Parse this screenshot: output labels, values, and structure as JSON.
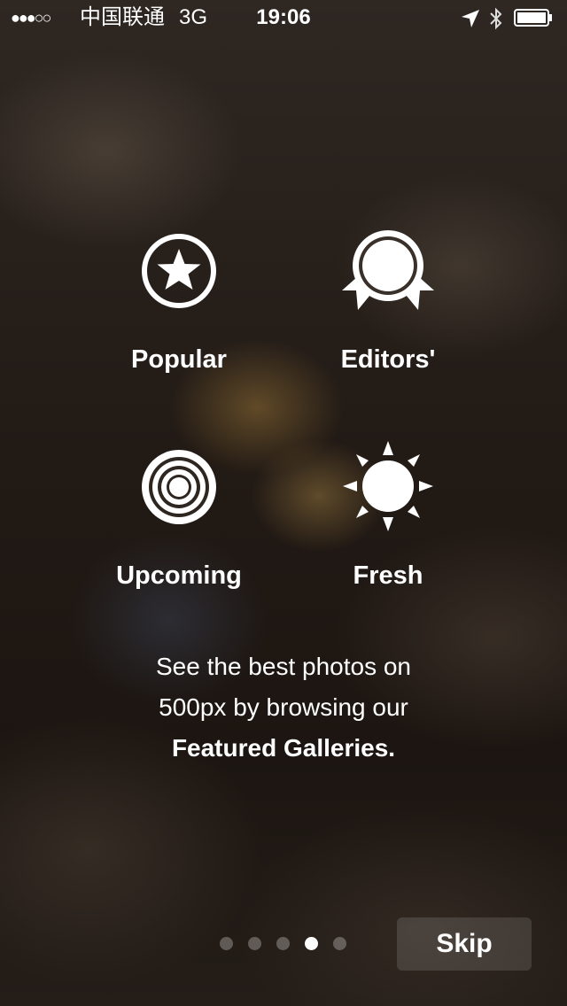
{
  "status_bar": {
    "signal": "●●●○○",
    "carrier": "中国联通",
    "network": "3G",
    "time": "19:06"
  },
  "categories": [
    {
      "label": "Popular",
      "icon": "star-circle-icon"
    },
    {
      "label": "Editors'",
      "icon": "award-ribbon-icon"
    },
    {
      "label": "Upcoming",
      "icon": "concentric-circles-icon"
    },
    {
      "label": "Fresh",
      "icon": "sun-icon"
    }
  ],
  "description": {
    "line1": "See the best photos on",
    "line2": "500px by browsing our",
    "line3": "Featured Galleries."
  },
  "pagination": {
    "total": 5,
    "active_index": 3
  },
  "skip_label": "Skip"
}
